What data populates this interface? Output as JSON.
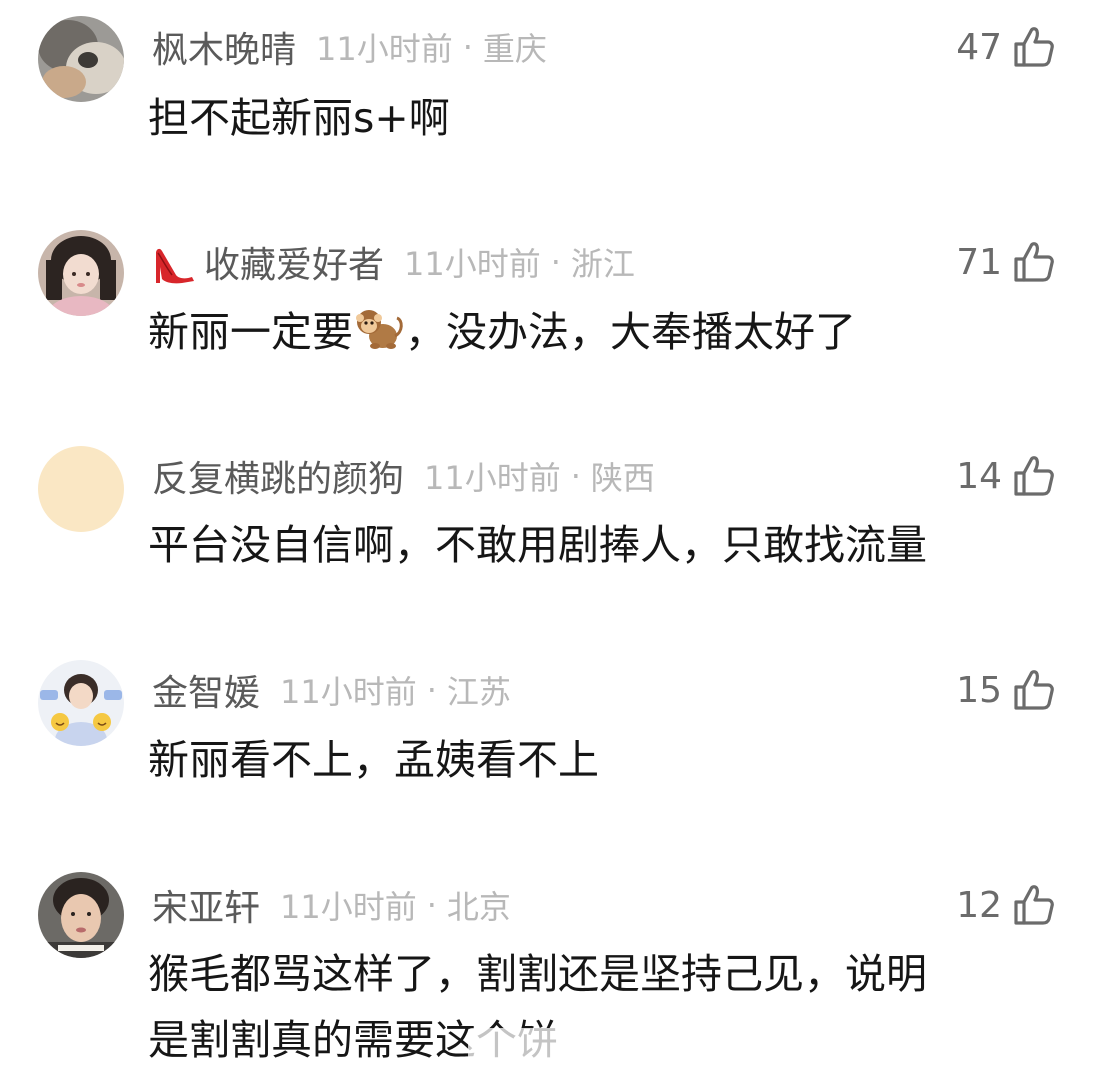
{
  "comments": [
    {
      "username": "枫木晚晴",
      "time": "11小时前",
      "separator": "·",
      "location": "重庆",
      "likes": "47",
      "text": "担不起新丽s+啊",
      "avatar": "cat-photo-avatar"
    },
    {
      "username": "收藏爱好者",
      "time": "11小时前",
      "separator": "·",
      "location": "浙江",
      "likes": "71",
      "text_before_emoji": "新丽一定要",
      "emoji": "monkey-emoji",
      "text_after_emoji": "，没办法，大奉播太好了",
      "badge": "high-heel-badge",
      "avatar": "girl-photo-avatar"
    },
    {
      "username": "反复横跳的颜狗",
      "time": "11小时前",
      "separator": "·",
      "location": "陕西",
      "likes": "14",
      "text": "平台没自信啊，不敢用剧捧人，只敢找流量",
      "avatar": "plain-beige-avatar"
    },
    {
      "username": "金智媛",
      "time": "11小时前",
      "separator": "·",
      "location": "江苏",
      "likes": "15",
      "text": "新丽看不上，孟姨看不上",
      "avatar": "kid-holding-cards-avatar"
    },
    {
      "username": "宋亚轩",
      "time": "11小时前",
      "separator": "·",
      "location": "北京",
      "likes": "12",
      "text_line1": "猴毛都骂这样了，割割还是坚持己见，说明",
      "text_line2": "是割割真的需要这个饼",
      "avatar": "person-photo-avatar"
    }
  ],
  "icons": {
    "like": "thumbs-up-outline-icon"
  },
  "colors": {
    "username": "#5a5a5a",
    "meta": "#b8b8b8",
    "text": "#161616",
    "likes": "#6b6b6b"
  }
}
